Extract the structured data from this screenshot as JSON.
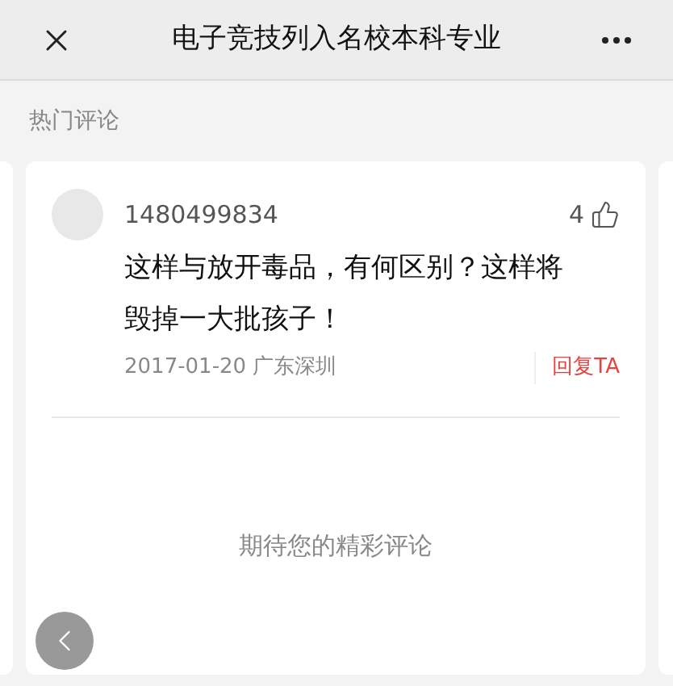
{
  "header": {
    "title": "电子竞技列入名校本科专业"
  },
  "section_title": "热门评论",
  "comments": [
    {
      "user": "1480499834",
      "likes": "4",
      "text": "这样与放开毒品，有何区别？这样将毁掉一大批孩子！",
      "date": "2017-01-20",
      "location": "广东深圳",
      "reply": "回复TA"
    }
  ],
  "empty_message": "期待您的精彩评论"
}
